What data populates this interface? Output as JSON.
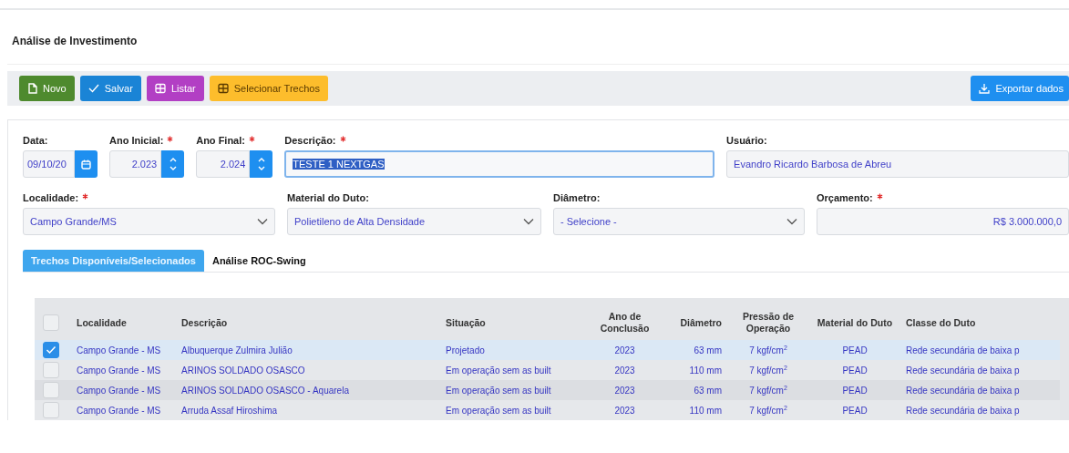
{
  "page_title": "Análise de Investimento",
  "toolbar": [
    {
      "label": "Novo",
      "kind": "new",
      "color": "#4e8a2e"
    },
    {
      "label": "Salvar",
      "kind": "save",
      "color": "#1a84d6"
    },
    {
      "label": "Listar",
      "kind": "grid",
      "color": "#b23fc4"
    },
    {
      "label": "Selecionar Trechos",
      "kind": "grid",
      "color": "#fdbd2c"
    }
  ],
  "export_button": {
    "label": "Exportar dados"
  },
  "form_rows": [
    [
      {
        "label": "Data:",
        "required": false,
        "kind": "date",
        "value": "09/10/20"
      },
      {
        "label": "Ano Inicial:",
        "required": true,
        "kind": "spin",
        "value": "2.023"
      },
      {
        "label": "Ano Final:",
        "required": true,
        "kind": "spin",
        "value": "2.024"
      },
      {
        "label": "Descrição:",
        "required": true,
        "kind": "text",
        "value": "TESTE 1 NEXTGAS",
        "focused": true,
        "text_selected": true
      },
      {
        "label": "Usuário:",
        "required": false,
        "kind": "text",
        "value": "Evandro Ricardo Barbosa de Abreu",
        "focused": false,
        "text_selected": false
      }
    ],
    [
      {
        "label": "Localidade:",
        "required": true,
        "kind": "select",
        "value": "Campo Grande/MS"
      },
      {
        "label": "Material do Duto:",
        "required": false,
        "kind": "select",
        "value": "Polietileno de Alta Densidade"
      },
      {
        "label": "Diâmetro:",
        "required": false,
        "kind": "select",
        "value": "- Selecione -"
      },
      {
        "label": "Orçamento:",
        "required": true,
        "kind": "money",
        "value": "R$ 3.000.000,0"
      }
    ]
  ],
  "tabs": [
    {
      "label": "Trechos Disponíveis/Selecionados",
      "selected": true
    },
    {
      "label": "Análise ROC-Swing",
      "selected": false
    }
  ],
  "table": {
    "header_checked": false,
    "columns": [
      "Localidade",
      "Descrição",
      "Situação",
      "Ano de Conclusão",
      "Diâmetro",
      "Pressão de Operação",
      "Material do Duto",
      "Classe do Duto"
    ],
    "rows": [
      {
        "selected": true,
        "cells": [
          "Campo Grande - MS",
          "Albuquerque Zulmira Julião",
          "Projetado",
          "2023",
          "63 mm",
          "7 kgf/cm$^{2}$",
          "PEAD",
          "Rede secundária de baixa p"
        ]
      },
      {
        "selected": false,
        "cells": [
          "Campo Grande - MS",
          "ARINOS SOLDADO OSASCO",
          "Em operação sem as built",
          "2023",
          "110 mm",
          "7 kgf/cm$^{2}$",
          "PEAD",
          "Rede secundária de baixa p"
        ]
      },
      {
        "selected": false,
        "cells": [
          "Campo Grande - MS",
          "ARINOS SOLDADO OSASCO - Aquarela",
          "Em operação sem as built",
          "2023",
          "63 mm",
          "7 kgf/cm$^{2}$",
          "PEAD",
          "Rede secundária de baixa p"
        ]
      },
      {
        "selected": false,
        "cells": [
          "Campo Grande - MS",
          "Arruda Assaf Hiroshima",
          "Em operação sem as built",
          "2023",
          "110 mm",
          "7 kgf/cm$^{2}$",
          "PEAD",
          "Rede secundária de baixa p"
        ]
      }
    ]
  }
}
